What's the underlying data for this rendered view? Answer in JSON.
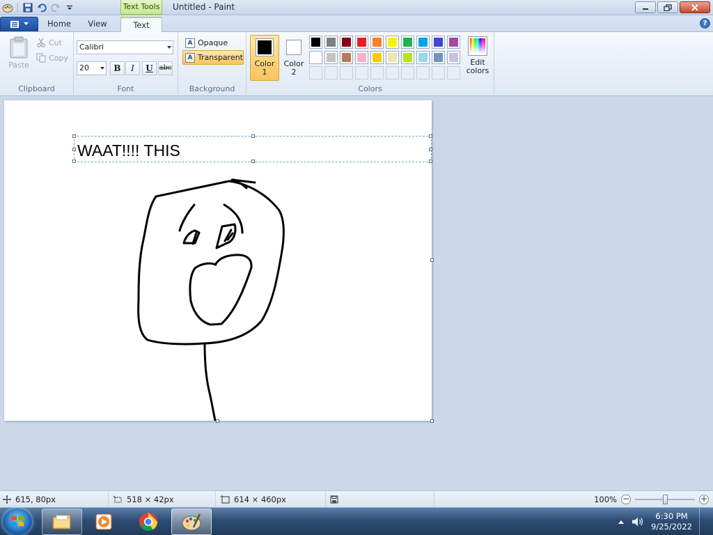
{
  "window": {
    "title": "Untitled - Paint",
    "context_tab_group": "Text Tools"
  },
  "tabs": [
    {
      "label": "Home",
      "active": false
    },
    {
      "label": "View",
      "active": false
    },
    {
      "label": "Text",
      "active": true
    }
  ],
  "ribbon": {
    "clipboard": {
      "label": "Clipboard",
      "paste": "Paste",
      "cut": "Cut",
      "copy": "Copy"
    },
    "font": {
      "label": "Font",
      "family": "Calibri",
      "size": "20",
      "bold": "B",
      "italic": "I",
      "underline": "U",
      "strikethrough": "abc"
    },
    "background": {
      "label": "Background",
      "opaque": "Opaque",
      "transparent": "Transparent",
      "selected": "transparent"
    },
    "colors": {
      "label": "Colors",
      "color1_label": "Color",
      "color1_num": "1",
      "color1": "#000000",
      "color2_label": "Color",
      "color2_num": "2",
      "color2": "#ffffff",
      "edit_label_1": "Edit",
      "edit_label_2": "colors",
      "palette": [
        "#000000",
        "#7f7f7f",
        "#880015",
        "#ed1c24",
        "#ff7f27",
        "#fff200",
        "#22b14c",
        "#00a2e8",
        "#3f48cc",
        "#a349a4",
        "#ffffff",
        "#c3c3c3",
        "#b97a57",
        "#ffaec9",
        "#ffc90e",
        "#efe4b0",
        "#b5e61d",
        "#99d9ea",
        "#7092be",
        "#c8bfe7"
      ],
      "empty_slots": 10
    }
  },
  "canvas": {
    "text": "WAAT!!!! THIS"
  },
  "status": {
    "cursor": "615, 80px",
    "selection": "518 × 42px",
    "canvas_size": "614 × 460px",
    "zoom": "100%",
    "zoom_level": 1.0
  },
  "taskbar": {
    "items": [
      "windows-explorer",
      "media-player",
      "chrome",
      "paint"
    ],
    "time": "6:30 PM",
    "date": "9/25/2022"
  },
  "icons": {
    "paint-app": "paint-app-icon",
    "save": "save-icon",
    "undo": "undo-icon",
    "redo": "redo-icon",
    "help": "help-icon"
  }
}
